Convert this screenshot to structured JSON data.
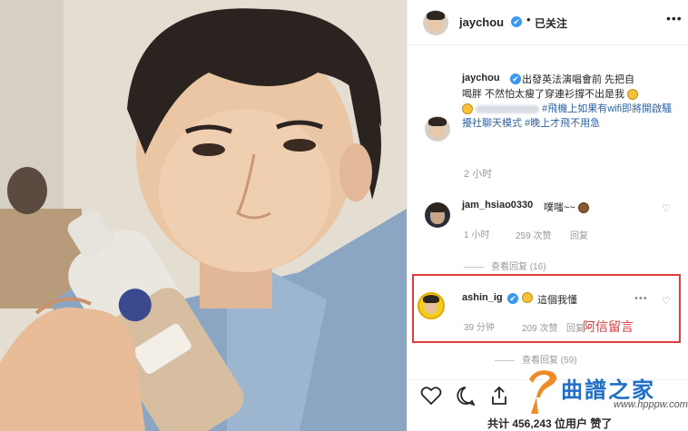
{
  "header": {
    "username": "jaychou",
    "verified_glyph": "✔",
    "separator": "•",
    "follow_status": "已关注",
    "more_glyph": "•••"
  },
  "caption": {
    "username": "jaychou",
    "text_1": "出發英法演唱會前 先把自",
    "text_2": "喝胖 不然怕太瘦了穿連衫撐不出是我",
    "hashtag": "#飛機上如果有wifi即將開啟騷擾社聊天模式",
    "text_3": "#晚上才飛不用急",
    "time": "2 小时"
  },
  "comments": [
    {
      "username": "jam_hsiao0330",
      "text": "噗嗤~~",
      "time": "1 小时",
      "likes": "259 次赞",
      "reply": "回复",
      "view_replies": "查看回复 (16)"
    },
    {
      "username": "ashin_ig",
      "text": "這個我懂",
      "time": "39 分钟",
      "likes": "209 次赞",
      "reply": "回复",
      "annotation": "阿信留言",
      "view_replies": "查看回复 (59)"
    }
  ],
  "likes_line": "共计 456,243 位用户 赞了",
  "watermark": {
    "title": "曲譜之家",
    "url": "www.hpppw.com"
  },
  "icons": {
    "heart": "heart-icon",
    "comment": "comment-icon",
    "share": "share-icon",
    "bookmark": "bookmark-icon",
    "more": "more-icon",
    "verified": "verified-badge-icon",
    "emoji": "emoji-icon"
  },
  "colors": {
    "verified_blue": "#3897f0",
    "hashtag_blue": "#2d63a8",
    "highlight_red": "#e23a3a",
    "watermark_blue": "#1f6fc8"
  }
}
